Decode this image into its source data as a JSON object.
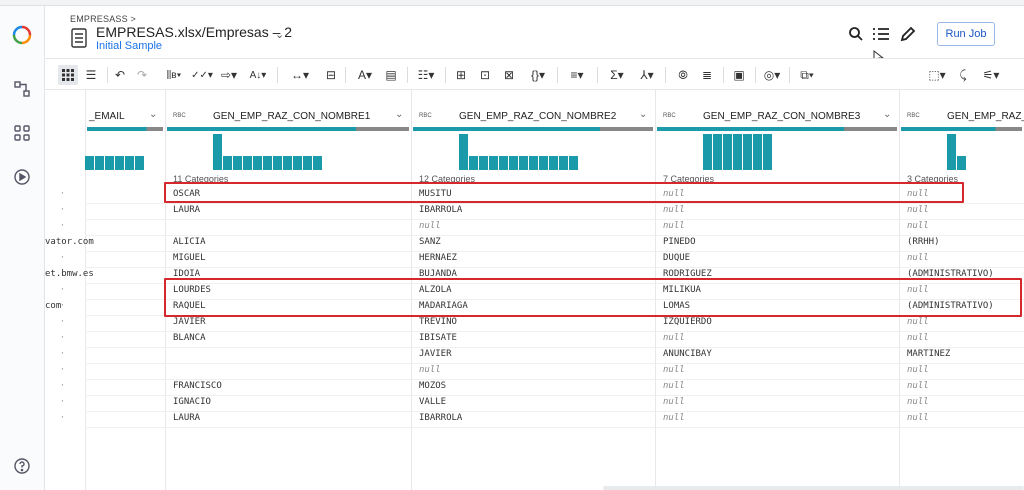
{
  "app": {
    "breadcrumb": "EMPRESASS >",
    "title": "EMPRESAS.xlsx/Empresas – 2",
    "subtitle": "Initial Sample",
    "run_job": "Run Job"
  },
  "toolbar": {
    "items": [
      "grid-view",
      "list-view",
      "undo",
      "redo",
      "column-type",
      "validate",
      "move",
      "sort",
      "move-columns",
      "pivot",
      "text",
      "format",
      "filter-rows",
      "merge",
      "split",
      "extract",
      "braces",
      "filter",
      "sum",
      "hierarchy",
      "join",
      "rules",
      "comment",
      "target",
      "multi-column",
      "selection",
      "transform-settings",
      "sliders"
    ]
  },
  "columns": [
    {
      "name": "_EMAIL",
      "type": "",
      "categories": "",
      "bars": [
        14,
        14,
        14,
        14,
        14,
        14
      ]
    },
    {
      "name": "GEN_EMP_RAZ_CON_NOMBRE1",
      "type": "RBC",
      "categories": "11 Categories",
      "bars": [
        36,
        14,
        14,
        14,
        14,
        14,
        14,
        14,
        14,
        14,
        14
      ]
    },
    {
      "name": "GEN_EMP_RAZ_CON_NOMBRE2",
      "type": "RBC",
      "categories": "12 Categories",
      "bars": [
        36,
        14,
        14,
        14,
        14,
        14,
        14,
        14,
        14,
        14,
        14,
        14
      ]
    },
    {
      "name": "GEN_EMP_RAZ_CON_NOMBRE3",
      "type": "RBC",
      "categories": "7 Categories",
      "bars": [
        36,
        36,
        36,
        36,
        36,
        36,
        36
      ]
    },
    {
      "name": "GEN_EMP_RAZ_C",
      "type": "RBC",
      "categories": "3 Categories",
      "bars": [
        36,
        14
      ]
    }
  ],
  "rows": [
    [
      "",
      "OSCAR",
      "MUSITU",
      "null",
      "null"
    ],
    [
      "",
      "LAURA",
      "IBARROLA",
      "null",
      "null"
    ],
    [
      "",
      "",
      "null",
      "null",
      "null"
    ],
    [
      "vator.com",
      "ALICIA",
      "SANZ",
      "PINEDO",
      "(RRHH)"
    ],
    [
      "",
      "MIGUEL",
      "HERNAEZ",
      "DUQUE",
      "null"
    ],
    [
      "et.bmw.es",
      "IDOIA",
      "BUJANDA",
      "RODRIGUEZ",
      "(ADMINISTRATIVO)"
    ],
    [
      "",
      "LOURDES",
      "ALZOLA",
      "MILIKUA",
      "null"
    ],
    [
      "com",
      "RAQUEL",
      "MADARIAGA",
      "LOMAS",
      "(ADMINISTRATIVO)"
    ],
    [
      "",
      "JAVIER",
      "TREVINO",
      "IZQUIERDO",
      "null"
    ],
    [
      "",
      "BLANCA",
      "IBISATE",
      "null",
      "null"
    ],
    [
      "",
      "",
      "JAVIER",
      "ANUNCIBAY",
      "MARTINEZ"
    ],
    [
      "",
      "",
      "null",
      "null",
      "null"
    ],
    [
      "",
      "FRANCISCO",
      "MOZOS",
      "null",
      "null"
    ],
    [
      "",
      "IGNACIO",
      "VALLE",
      "null",
      "null"
    ],
    [
      "",
      "LAURA",
      "IBARROLA",
      "null",
      "null"
    ]
  ],
  "row_marker": "·",
  "colors": {
    "accent": "#1b9aaa",
    "highlight": "#d4282c",
    "link": "#1a73e8"
  }
}
